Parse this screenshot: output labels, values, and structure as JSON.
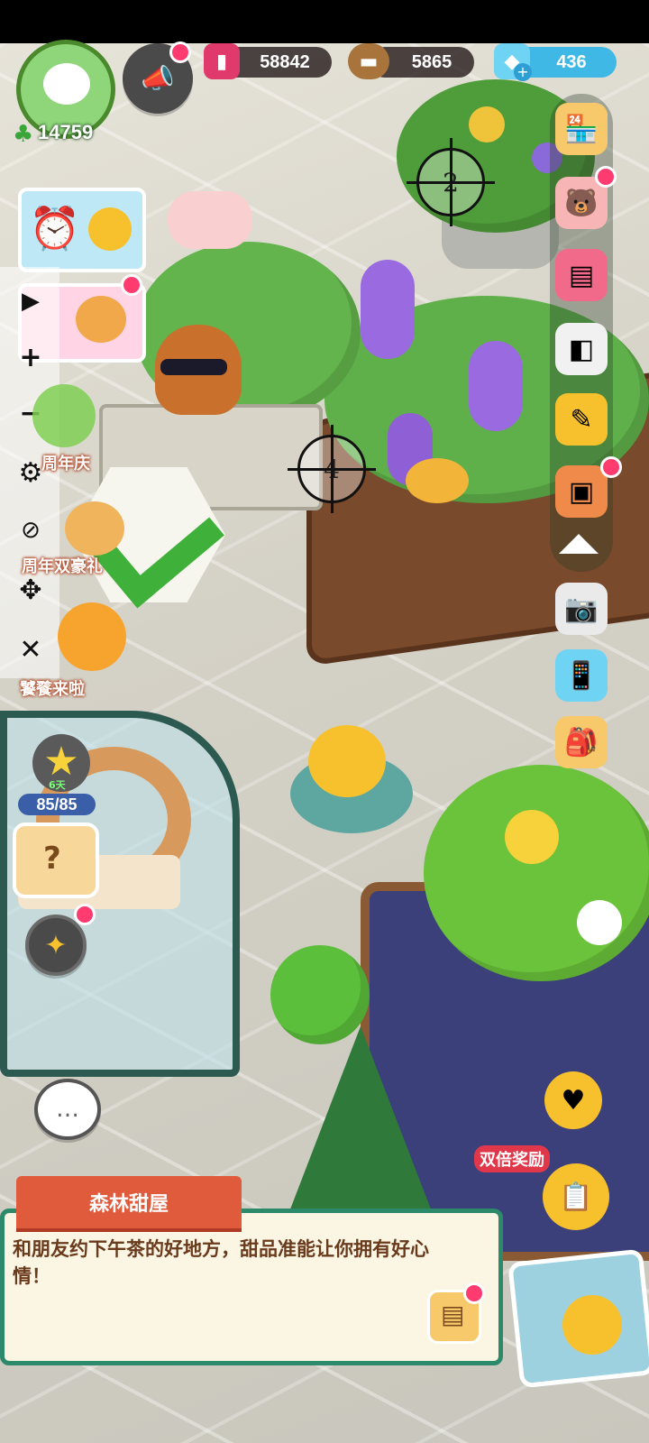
{
  "player": {
    "level_value": "14759"
  },
  "resources": {
    "potion": {
      "value": "58842",
      "icon": "potion-jar-icon"
    },
    "wood": {
      "value": "5865",
      "icon": "wood-log-icon"
    },
    "gem": {
      "value": "436",
      "icon": "blue-gem-icon"
    }
  },
  "markers": {
    "marker_a": "2",
    "marker_b": "4"
  },
  "events": [
    {
      "label": "周年庆"
    },
    {
      "label": "周年双豪礼"
    },
    {
      "label": "饕餮来啦"
    }
  ],
  "star_progress": {
    "sub": "6天",
    "value": "85/85"
  },
  "double_reward": "双倍奖励",
  "info": {
    "title": "森林甜屋",
    "description": "和朋友约下午茶的好地方，甜品准能让你拥有好心情！"
  },
  "tools": [
    "play",
    "zoom-in",
    "zoom-out",
    "settings",
    "hide",
    "move",
    "close"
  ],
  "colors": {
    "accent_red": "#e05a3c",
    "panel_border": "#2c8a6a",
    "gem_blue": "#3fb8e6",
    "badge": "#ff3b6f"
  }
}
